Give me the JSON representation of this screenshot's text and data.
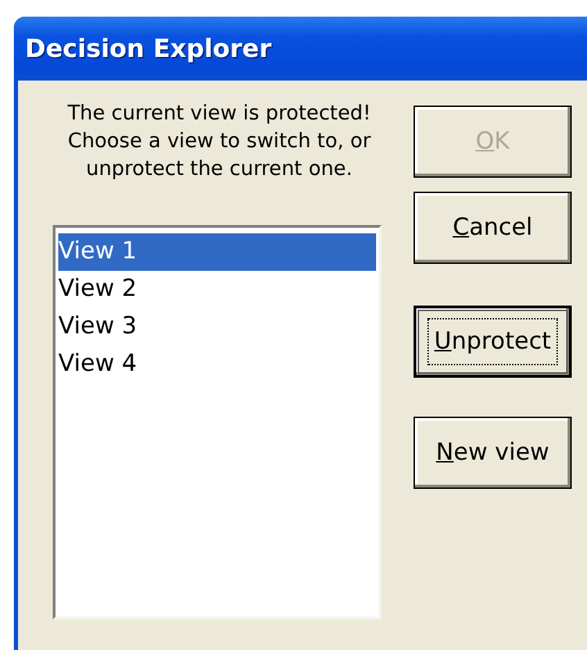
{
  "window": {
    "title": "Decision Explorer"
  },
  "message": "The current view is protected! Choose a view to switch to, or unprotect the current one.",
  "views": [
    {
      "label": "View 1",
      "selected": true
    },
    {
      "label": "View 2",
      "selected": false
    },
    {
      "label": "View 3",
      "selected": false
    },
    {
      "label": "View 4",
      "selected": false
    }
  ],
  "buttons": [
    {
      "key": "O",
      "rest": "K",
      "disabled": true,
      "focused": false
    },
    {
      "key": "C",
      "rest": "ancel",
      "disabled": false,
      "focused": false
    },
    {
      "key": "U",
      "rest": "nprotect",
      "disabled": false,
      "focused": true
    },
    {
      "key": "N",
      "rest": "ew view",
      "disabled": false,
      "focused": false
    }
  ]
}
